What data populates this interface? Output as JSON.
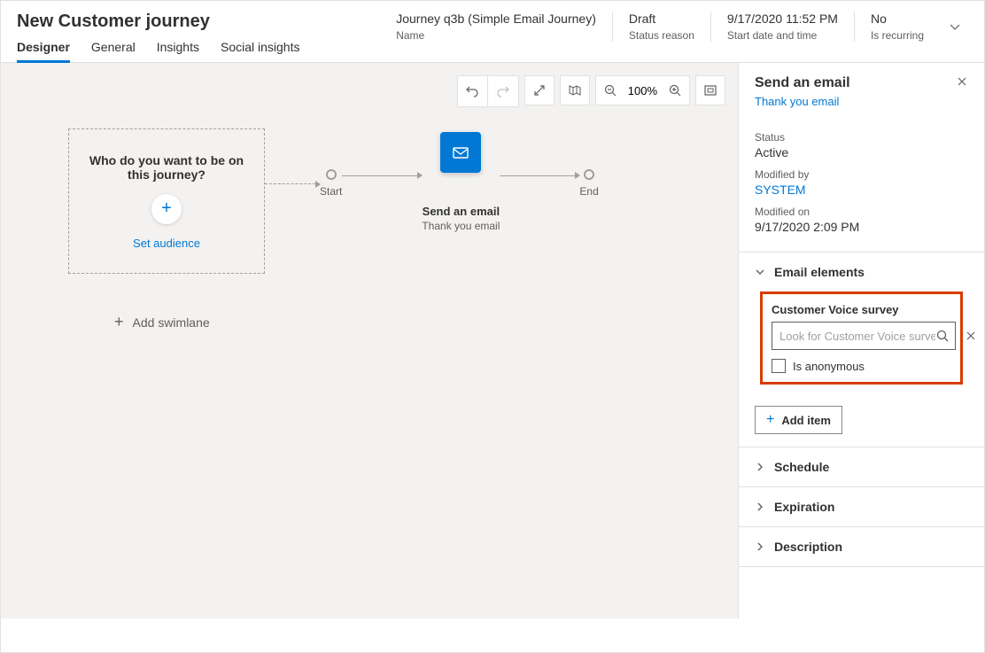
{
  "header": {
    "title": "New Customer journey",
    "meta": [
      {
        "value": "Journey q3b (Simple Email Journey)",
        "label": "Name"
      },
      {
        "value": "Draft",
        "label": "Status reason"
      },
      {
        "value": "9/17/2020 11:52 PM",
        "label": "Start date and time"
      },
      {
        "value": "No",
        "label": "Is recurring"
      }
    ]
  },
  "tabs": [
    "Designer",
    "General",
    "Insights",
    "Social insights"
  ],
  "toolbar": {
    "zoom": "100%"
  },
  "canvas": {
    "audience_question": "Who do you want to be on this journey?",
    "set_audience": "Set audience",
    "start": "Start",
    "end": "End",
    "email_tile_title": "Send an email",
    "email_tile_sub": "Thank you email",
    "add_swimlane": "Add swimlane"
  },
  "panel": {
    "title": "Send an email",
    "link": "Thank you email",
    "status_label": "Status",
    "status_value": "Active",
    "modified_by_label": "Modified by",
    "modified_by_value": "SYSTEM",
    "modified_on_label": "Modified on",
    "modified_on_value": "9/17/2020 2:09 PM",
    "sections": {
      "email_elements": "Email elements",
      "schedule": "Schedule",
      "expiration": "Expiration",
      "description": "Description"
    },
    "survey_label": "Customer Voice survey",
    "survey_placeholder": "Look for Customer Voice survey",
    "anon_label": "Is anonymous",
    "add_item": "Add item"
  }
}
